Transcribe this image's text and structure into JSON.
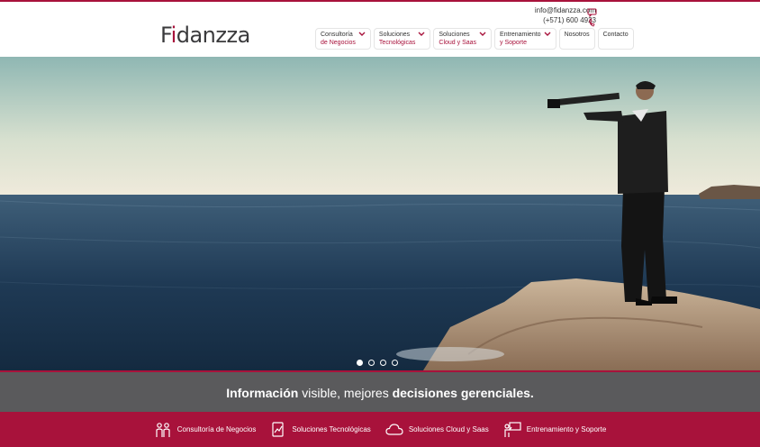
{
  "brand": {
    "logo_part1": "F",
    "logo_accent": "i",
    "logo_part2": "danzza",
    "accent_color": "#a8123b"
  },
  "contact": {
    "email": "info@fidanzza.com",
    "phone": "(+571) 600 4923",
    "email_icon": "chat-icon",
    "phone_icon": "phone-icon"
  },
  "nav": [
    {
      "line1": "Consultoría",
      "line2": "de Negocios",
      "has_dropdown": true
    },
    {
      "line1": "Soluciones",
      "line2": "Tecnológicas",
      "has_dropdown": true
    },
    {
      "line1": "Soluciones",
      "line2": "Cloud y Saas",
      "has_dropdown": true
    },
    {
      "line1": "Entrenamiento",
      "line2": "y Soporte",
      "has_dropdown": true
    },
    {
      "line1": "Nosotros",
      "line2": "",
      "has_dropdown": false
    },
    {
      "line1": "Contacto",
      "line2": "",
      "has_dropdown": false
    }
  ],
  "hero": {
    "slides": 4,
    "active_slide": 1,
    "image": "man-with-telescope-on-rock-by-sea"
  },
  "tagline": {
    "part1": "Información",
    "part2": " visible, mejores ",
    "part3": "decisiones gerenciales."
  },
  "footer": [
    {
      "label": "Consultoría de Negocios",
      "icon": "people-icon"
    },
    {
      "label": "Soluciones Tecnológicas",
      "icon": "document-chart-icon"
    },
    {
      "label": "Soluciones Cloud y Saas",
      "icon": "cloud-icon"
    },
    {
      "label": "Entrenamiento y Soporte",
      "icon": "presenter-board-icon"
    }
  ]
}
